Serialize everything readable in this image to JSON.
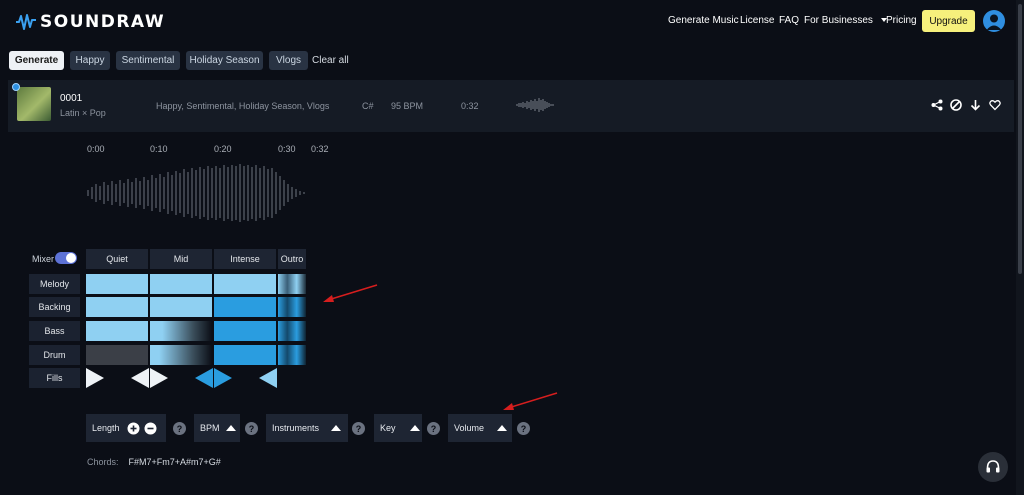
{
  "header": {
    "logo_text": "SOUNDRAW",
    "nav": [
      "Generate Music",
      "License",
      "FAQ",
      "For Businesses",
      "Pricing"
    ],
    "upgrade_label": "Upgrade"
  },
  "tags": {
    "items": [
      "Generate",
      "Happy",
      "Sentimental",
      "Holiday Season",
      "Vlogs"
    ],
    "clear_all": "Clear all"
  },
  "track": {
    "id": "0001",
    "genre": "Latin × Pop",
    "moods": "Happy, Sentimental, Holiday Season, Vlogs",
    "key": "C#",
    "bpm": "95 BPM",
    "length": "0:32"
  },
  "timeline": [
    "0:00",
    "0:10",
    "0:20",
    "0:30",
    "0:32"
  ],
  "mixer": {
    "toggle_label": "Mixer",
    "toggle_on": true,
    "sections": [
      "Quiet",
      "Mid",
      "Intense",
      "Outro"
    ],
    "rows": [
      "Melody",
      "Backing",
      "Bass",
      "Drum",
      "Fills"
    ]
  },
  "controls": {
    "length": "Length",
    "bpm": "BPM",
    "instruments": "Instruments",
    "key": "Key",
    "volume": "Volume",
    "help": "?"
  },
  "chords": {
    "label": "Chords:",
    "value": "F#M7+Fm7+A#m7+G#"
  },
  "colors": {
    "accent": "#2f8ee0",
    "upgrade": "#f6f07c",
    "cell_light": "#8fd0f2",
    "cell_blue": "#2a9de0",
    "annotation": "#d61e1e"
  }
}
